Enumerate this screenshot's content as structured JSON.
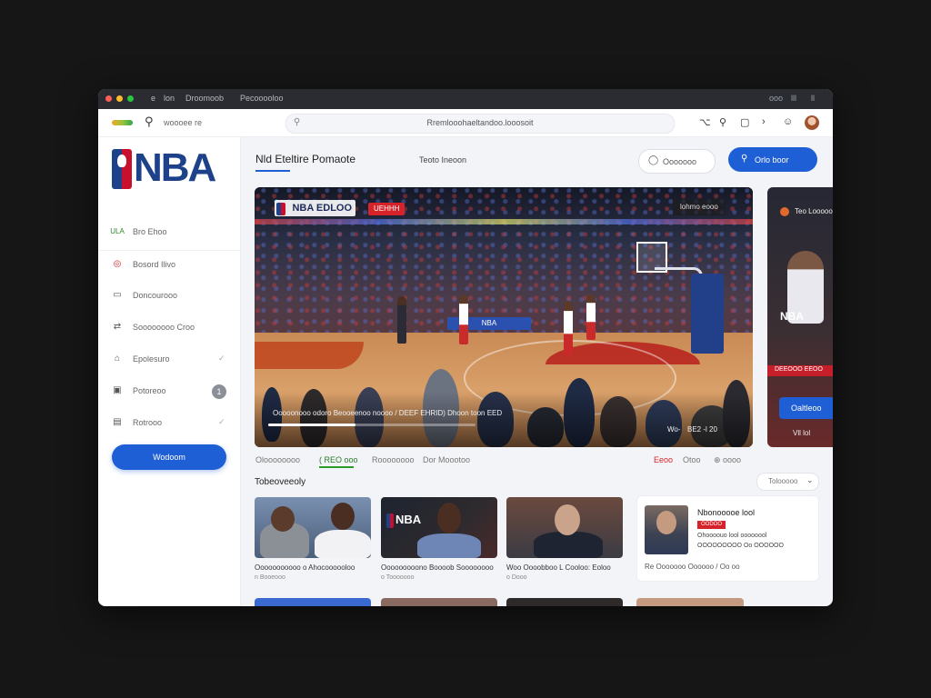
{
  "titlebar": {
    "dots": [
      "#ff5f57",
      "#febc2e",
      "#28c840"
    ],
    "items": [
      "e",
      "lon",
      "Droomoob",
      "Pecooooloo"
    ],
    "right_icons": [
      "ooo",
      "lll",
      "ll"
    ]
  },
  "toolbar": {
    "search_label": "woooee re",
    "address": "Rremlooohaeltandoo.looosoit",
    "icons": [
      "share-icon",
      "search-icon",
      "window-icon",
      "chevron-icon",
      "user-icon"
    ]
  },
  "sidebar": {
    "logo_text": "NBA",
    "items": [
      {
        "label": "Bro Ehoo",
        "icon": "ULA"
      },
      {
        "label": "Bosord Ilivo",
        "icon": "◎"
      },
      {
        "label": "Doncourooo",
        "icon": "▭"
      },
      {
        "label": "Soooooooo Croo",
        "icon": "⇄"
      },
      {
        "label": "Epolesuro",
        "icon": "⌂"
      },
      {
        "label": "Potoreoo",
        "icon": "▣",
        "badge": "1"
      },
      {
        "label": "Rotrooo",
        "icon": "▤"
      }
    ],
    "button_label": "Wodoom"
  },
  "main": {
    "page_title": "Nld Eteltire Pomaote",
    "subtab": "Teoto Ineoon",
    "outline_button": "Ooooooo",
    "primary_button": "Orlo boor",
    "player": {
      "brand_text": "NBA EDLOO",
      "red_tag": "UEHHH",
      "top_right_tag": "lohmo eooo",
      "caption": "Ooooonooo odoro Beooeenoo noooo / DEEF EHRID) Dhoon toon EED",
      "time_right": "BE2 -l 20",
      "ctrl_label": "Wo-",
      "progress": 0.42
    },
    "side_card": {
      "title": "Teo Looooo",
      "logo_text": "NBA",
      "red_text": "DEEOOO EEOO",
      "button_label": "Oaltleoo",
      "bottom_text": "Vll lol"
    },
    "player_tabs": [
      {
        "label": "Oloooooooo",
        "state": "normal"
      },
      {
        "label": "( REO ooo",
        "state": "active"
      },
      {
        "label": "Roooooooo",
        "state": "normal"
      },
      {
        "label": "Dor Moootoo",
        "state": "normal"
      },
      {
        "label": "Eeoo",
        "state": "red"
      },
      {
        "label": "Otoo",
        "state": "normal"
      },
      {
        "label": "⊕ oooo",
        "state": "normal"
      }
    ],
    "section_title": "Tobeoveeoly",
    "dropdown_value": "Tolooooo",
    "thumbnails": [
      {
        "caption": "Ooooooooooo o Ahocoooooloo",
        "sub": "n Booeooo"
      },
      {
        "caption": "Ooooooooono Boooob Soooooooo",
        "sub": "o Tooooooo"
      },
      {
        "caption": "Woo Oooobboo L Cooloo: Eoloo",
        "sub": "o Dooo"
      }
    ],
    "feature_card": {
      "title": "Nbonooooe lool",
      "red_tag": "OODOO",
      "line1": "Ohoooouo lool oooooool",
      "line2": "OOOOOOOOO Oo OOOOOO",
      "meta": "Re  Ooooooo Oooooo  /  Oo  oo"
    }
  }
}
